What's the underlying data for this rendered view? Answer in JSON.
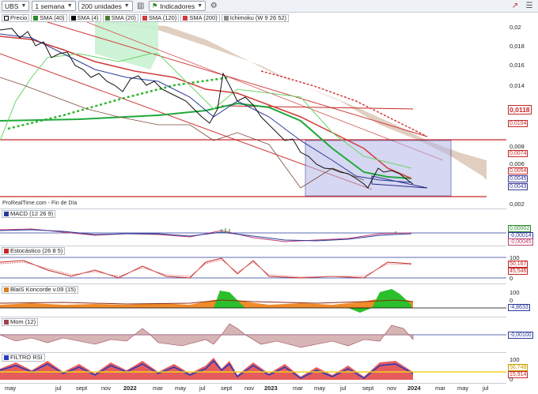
{
  "toolbar": {
    "symbol": "UBS",
    "timeframe": "1 semana",
    "units": "200 unidades",
    "indicators": "Indicadores"
  },
  "legend": [
    {
      "label": "Precio",
      "color": "#000000"
    },
    {
      "label": "SMA (40)",
      "color": "#2b8a2b"
    },
    {
      "label": "SMA (4)",
      "color": "#000000"
    },
    {
      "label": "SMA (20)",
      "color": "#4b7d2a"
    },
    {
      "label": "SMA (120)",
      "color": "#d13b3b"
    },
    {
      "label": "SMA (200)",
      "color": "#d13b3b"
    },
    {
      "label": "Ichimoku (W 9 26 52)",
      "color": "#8a8a8a"
    }
  ],
  "price_axis": {
    "ticks": [
      "0,02",
      "0,018",
      "0,016",
      "0,014",
      "0,008",
      "0,006",
      "0,002"
    ],
    "tags": [
      {
        "text": "0,0118",
        "color": "#c62828"
      },
      {
        "text": "0,0104",
        "color": "#c62828"
      },
      {
        "text": "0,0074",
        "color": "#c62828"
      },
      {
        "text": "0,0054",
        "color": "#c62828"
      },
      {
        "text": "0,0045",
        "color": "#3a3a9a"
      },
      {
        "text": "0,0043",
        "color": "#3a3a9a"
      }
    ]
  },
  "footnote": "ProRealTime.com - Fin de Día",
  "panels": {
    "macd": {
      "label": "MACD (12 26 9)",
      "tags": [
        "0,00002",
        "-0,00014",
        "-0,00045"
      ]
    },
    "stoch": {
      "label": "Estocástico (26 8 5)",
      "ticks": [
        "100",
        "0"
      ],
      "tags": [
        "50,167",
        "45,546"
      ]
    },
    "koncorde": {
      "label": "BlaiS Koncorde v.09 (15)",
      "ticks": [
        "100",
        "0"
      ],
      "tags": [
        "-4,8633"
      ]
    },
    "mom": {
      "label": "Mom (12)",
      "tags": [
        "-0,00100"
      ]
    },
    "rsi": {
      "label": "FILTRO RSI",
      "ticks": [
        "100",
        "0"
      ],
      "tags": [
        "56,748",
        "15,914"
      ]
    }
  },
  "x_axis": [
    "may",
    "jul",
    "sept",
    "nov",
    "2022",
    "mar",
    "may",
    "jul",
    "sept",
    "nov",
    "2023",
    "mar",
    "may",
    "jul",
    "sept",
    "nov",
    "2024",
    "mar",
    "may",
    "jul"
  ]
}
